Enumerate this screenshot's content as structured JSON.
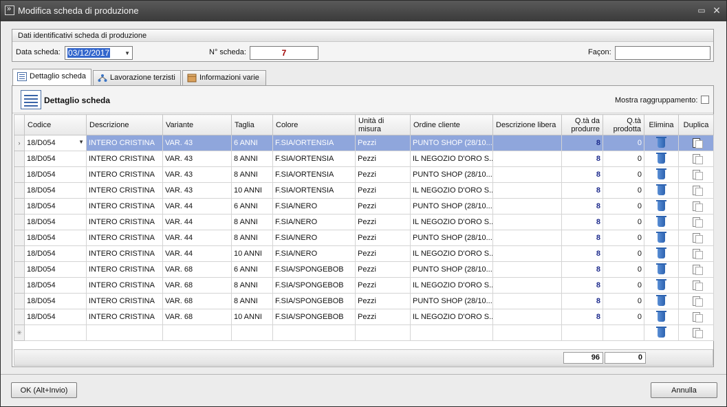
{
  "window": {
    "title": "Modifica scheda di produzione",
    "icon": "app-logo-icon"
  },
  "ident": {
    "title": "Dati identificativi scheda di produzione",
    "date_label": "Data scheda:",
    "date_value": "03/12/2017",
    "number_label": "N° scheda:",
    "number_value": "7",
    "facon_label": "Façon:",
    "facon_value": ""
  },
  "tabs": [
    {
      "label": "Dettaglio scheda",
      "icon": "list-icon",
      "active": true
    },
    {
      "label": "Lavorazione terzisti",
      "icon": "workflow-icon",
      "active": false
    },
    {
      "label": "Informazioni varie",
      "icon": "package-icon",
      "active": false
    }
  ],
  "panel": {
    "title": "Dettaglio scheda",
    "toggle_label": "Mostra raggruppamento:"
  },
  "columns": [
    "Codice",
    "Descrizione",
    "Variante",
    "Taglia",
    "Colore",
    "Unità di misura",
    "Ordine cliente",
    "Descrizione libera",
    "Q.tà da produrre",
    "Q.tà prodotta",
    "Elimina",
    "Duplica"
  ],
  "rows": [
    {
      "codice": "18/D054",
      "descrizione": "INTERO CRISTINA",
      "variante": "VAR. 43",
      "taglia": "6 ANNI",
      "colore": "F.SIA/ORTENSIA",
      "um": "Pezzi",
      "ordine": "PUNTO SHOP (28/10...",
      "desc_libera": "",
      "qta_prod": "8",
      "qta_fatta": "0"
    },
    {
      "codice": "18/D054",
      "descrizione": "INTERO CRISTINA",
      "variante": "VAR. 43",
      "taglia": "8 ANNI",
      "colore": "F.SIA/ORTENSIA",
      "um": "Pezzi",
      "ordine": "IL NEGOZIO D'ORO S...",
      "desc_libera": "",
      "qta_prod": "8",
      "qta_fatta": "0"
    },
    {
      "codice": "18/D054",
      "descrizione": "INTERO CRISTINA",
      "variante": "VAR. 43",
      "taglia": "8 ANNI",
      "colore": "F.SIA/ORTENSIA",
      "um": "Pezzi",
      "ordine": "PUNTO SHOP (28/10...",
      "desc_libera": "",
      "qta_prod": "8",
      "qta_fatta": "0"
    },
    {
      "codice": "18/D054",
      "descrizione": "INTERO CRISTINA",
      "variante": "VAR. 43",
      "taglia": "10 ANNI",
      "colore": "F.SIA/ORTENSIA",
      "um": "Pezzi",
      "ordine": "IL NEGOZIO D'ORO S...",
      "desc_libera": "",
      "qta_prod": "8",
      "qta_fatta": "0"
    },
    {
      "codice": "18/D054",
      "descrizione": "INTERO CRISTINA",
      "variante": "VAR. 44",
      "taglia": "6 ANNI",
      "colore": "F.SIA/NERO",
      "um": "Pezzi",
      "ordine": "PUNTO SHOP (28/10...",
      "desc_libera": "",
      "qta_prod": "8",
      "qta_fatta": "0"
    },
    {
      "codice": "18/D054",
      "descrizione": "INTERO CRISTINA",
      "variante": "VAR. 44",
      "taglia": "8 ANNI",
      "colore": "F.SIA/NERO",
      "um": "Pezzi",
      "ordine": "IL NEGOZIO D'ORO S...",
      "desc_libera": "",
      "qta_prod": "8",
      "qta_fatta": "0"
    },
    {
      "codice": "18/D054",
      "descrizione": "INTERO CRISTINA",
      "variante": "VAR. 44",
      "taglia": "8 ANNI",
      "colore": "F.SIA/NERO",
      "um": "Pezzi",
      "ordine": "PUNTO SHOP (28/10...",
      "desc_libera": "",
      "qta_prod": "8",
      "qta_fatta": "0"
    },
    {
      "codice": "18/D054",
      "descrizione": "INTERO CRISTINA",
      "variante": "VAR. 44",
      "taglia": "10 ANNI",
      "colore": "F.SIA/NERO",
      "um": "Pezzi",
      "ordine": "IL NEGOZIO D'ORO S...",
      "desc_libera": "",
      "qta_prod": "8",
      "qta_fatta": "0"
    },
    {
      "codice": "18/D054",
      "descrizione": "INTERO CRISTINA",
      "variante": "VAR. 68",
      "taglia": "6 ANNI",
      "colore": "F.SIA/SPONGEBOB",
      "um": "Pezzi",
      "ordine": "PUNTO SHOP (28/10...",
      "desc_libera": "",
      "qta_prod": "8",
      "qta_fatta": "0"
    },
    {
      "codice": "18/D054",
      "descrizione": "INTERO CRISTINA",
      "variante": "VAR. 68",
      "taglia": "8 ANNI",
      "colore": "F.SIA/SPONGEBOB",
      "um": "Pezzi",
      "ordine": "IL NEGOZIO D'ORO S...",
      "desc_libera": "",
      "qta_prod": "8",
      "qta_fatta": "0"
    },
    {
      "codice": "18/D054",
      "descrizione": "INTERO CRISTINA",
      "variante": "VAR. 68",
      "taglia": "8 ANNI",
      "colore": "F.SIA/SPONGEBOB",
      "um": "Pezzi",
      "ordine": "PUNTO SHOP (28/10...",
      "desc_libera": "",
      "qta_prod": "8",
      "qta_fatta": "0"
    },
    {
      "codice": "18/D054",
      "descrizione": "INTERO CRISTINA",
      "variante": "VAR. 68",
      "taglia": "10 ANNI",
      "colore": "F.SIA/SPONGEBOB",
      "um": "Pezzi",
      "ordine": "IL NEGOZIO D'ORO S...",
      "desc_libera": "",
      "qta_prod": "8",
      "qta_fatta": "0"
    }
  ],
  "totals": {
    "qta_prod": "96",
    "qta_fatta": "0"
  },
  "buttons": {
    "ok": "OK (Alt+Invio)",
    "cancel": "Annulla"
  },
  "colors": {
    "selection": "#8fa6dc",
    "quantity": "#1c2a8c",
    "number": "#a00000"
  }
}
